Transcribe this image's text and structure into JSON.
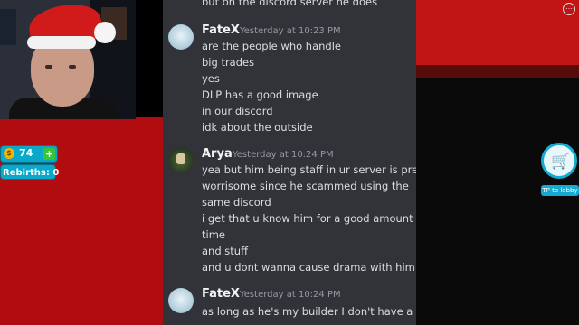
{
  "hud": {
    "coins": "74",
    "plus": "+",
    "coin_symbol": "$",
    "rebirths_label": "Rebirths: 0",
    "tp_label": "TP to lobby",
    "cart_icon": "🛒",
    "menu_icon": "⋯"
  },
  "chat": {
    "top_line": "but on the discord server he does",
    "messages": [
      {
        "author": "FateX",
        "time": "Yesterday at 10:23 PM",
        "lines": [
          "are the people who handle",
          "big trades",
          "yes",
          "DLP has a good image",
          "in our discord",
          "idk about the outside"
        ]
      },
      {
        "author": "Arya",
        "time": "Yesterday at 10:24 PM",
        "lines": [
          "yea but him being staff in ur server is pretty",
          "worrisome since he scammed using the",
          "same discord",
          "i get that u know him for a good amount of",
          "time",
          "and stuff",
          "and u dont wanna cause drama with him"
        ]
      },
      {
        "author": "FateX",
        "time": "Yesterday at 10:24 PM",
        "lines": [
          "as long as he's my builder I don't have a"
        ]
      }
    ]
  }
}
